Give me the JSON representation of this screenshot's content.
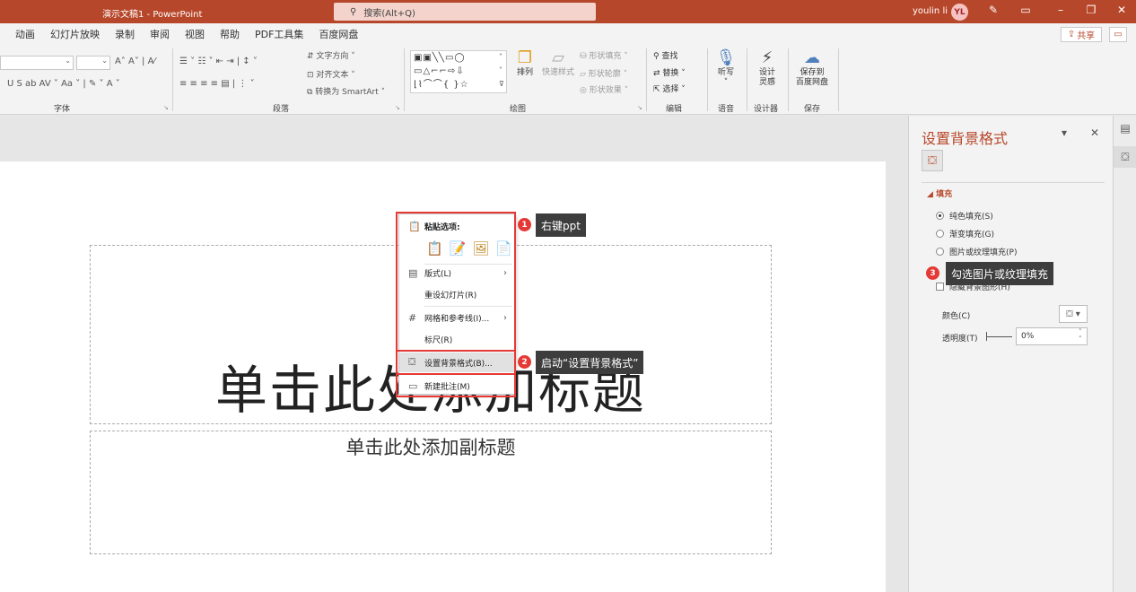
{
  "titlebar": {
    "doc_title": "演示文稿1 - PowerPoint",
    "search_placeholder": "搜索(Alt+Q)",
    "user_name": "youlin li",
    "avatar_initials": "YL"
  },
  "tabs": [
    "动画",
    "幻灯片放映",
    "录制",
    "审阅",
    "视图",
    "帮助",
    "PDF工具集",
    "百度网盘"
  ],
  "share_label": "共享",
  "ribbon": {
    "font_group": "字体",
    "paragraph_group": "段落",
    "drawing_group": "绘图",
    "editing_group": "编辑",
    "voice_group": "语音",
    "designer_group": "设计器",
    "save_group": "保存",
    "text_direction": "文字方向",
    "align_text": "对齐文本",
    "convert_smartart": "转换为 SmartArt",
    "arrange": "排列",
    "quick_styles": "快速样式",
    "shape_fill": "形状填充",
    "shape_outline": "形状轮廓",
    "shape_effects": "形状效果",
    "find": "查找",
    "replace": "替换",
    "select": "选择",
    "dictate": "听写",
    "design_ideas": "设计\n灵感",
    "design_ideas_line1": "设计",
    "design_ideas_line2": "灵感",
    "save_to_baidu_line1": "保存到",
    "save_to_baidu_line2": "百度网盘"
  },
  "slide": {
    "title_placeholder": "单击此处添加标题",
    "subtitle_placeholder": "单击此处添加副标题"
  },
  "context_menu": {
    "paste_options": "粘贴选项:",
    "layout": "版式(L)",
    "reset_slide": "重设幻灯片(R)",
    "grid_guides": "网格和参考线(I)...",
    "ruler": "标尺(R)",
    "format_background": "设置背景格式(B)...",
    "new_comment": "新建批注(M)"
  },
  "callouts": {
    "step1_num": "1",
    "step1_text": "右键ppt",
    "step2_num": "2",
    "step2_text": "启动“设置背景格式”",
    "step3_num": "3",
    "step3_text": "勾选图片或纹理填充"
  },
  "format_pane": {
    "title": "设置背景格式",
    "fill_section": "填充",
    "solid_fill": "纯色填充(S)",
    "gradient_fill": "渐变填充(G)",
    "picture_fill": "图片或纹理填充(P)",
    "hide_bg": "隐藏背景图形(H)",
    "color_label": "颜色(C)",
    "transparency_label": "透明度(T)",
    "transparency_value": "0%"
  },
  "colors": {
    "accent": "#b7472a",
    "callout_red": "#e53935"
  }
}
